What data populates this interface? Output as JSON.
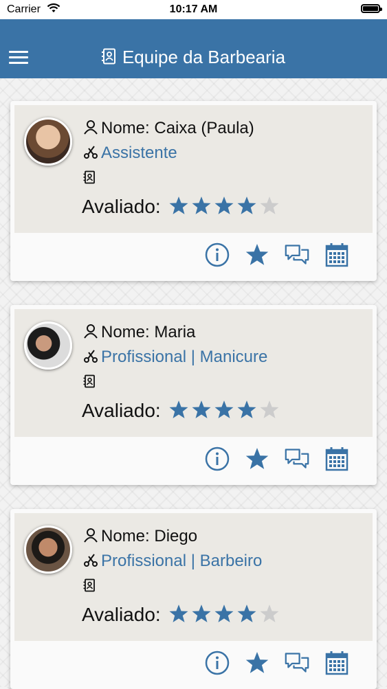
{
  "status_bar": {
    "carrier": "Carrier",
    "time": "10:17 AM"
  },
  "header": {
    "title": "Equipe da Barbearia",
    "menu_icon": "hamburger-icon",
    "title_icon": "contact-card-icon"
  },
  "team": [
    {
      "name": "Nome: Caixa (Paula)",
      "role": "Assistente",
      "rating_label": "Avaliado:",
      "rating": 4,
      "rating_max": 5
    },
    {
      "name": "Nome: Maria",
      "role": "Profissional | Manicure",
      "rating_label": "Avaliado:",
      "rating": 4,
      "rating_max": 5
    },
    {
      "name": "Nome: Diego",
      "role": "Profissional | Barbeiro",
      "rating_label": "Avaliado:",
      "rating": 4,
      "rating_max": 5
    }
  ],
  "card_actions": [
    "info-icon",
    "star-icon",
    "chat-icon",
    "calendar-icon"
  ],
  "colors": {
    "primary": "#3a73a6",
    "star_on": "#3a73a6",
    "star_off": "#cccccc",
    "card_top": "#ebe9e4"
  }
}
